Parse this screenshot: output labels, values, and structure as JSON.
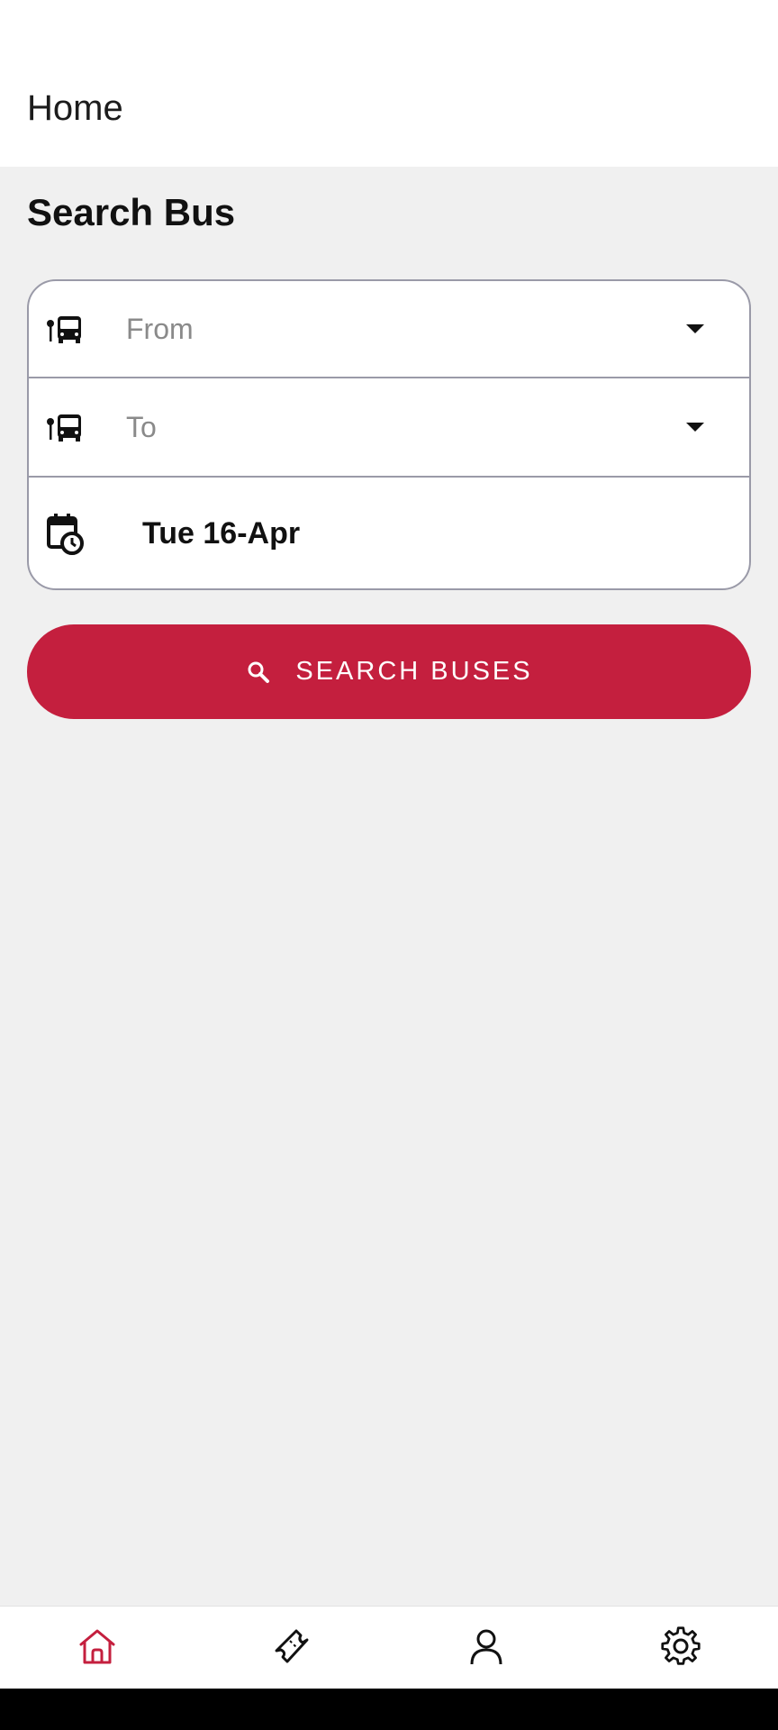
{
  "app_bar": {
    "title": "Home"
  },
  "search": {
    "section_title": "Search Bus",
    "from_placeholder": "From",
    "to_placeholder": "To",
    "date_value": "Tue 16-Apr",
    "button_label": "SEARCH BUSES"
  },
  "nav": {
    "items": [
      {
        "name": "home",
        "icon": "home-icon",
        "active": true
      },
      {
        "name": "tickets",
        "icon": "ticket-icon",
        "active": false
      },
      {
        "name": "profile",
        "icon": "person-icon",
        "active": false
      },
      {
        "name": "settings",
        "icon": "gear-icon",
        "active": false
      }
    ]
  },
  "colors": {
    "accent": "#c41f3e",
    "background": "#f0f0f0",
    "border": "#9a9aa8"
  }
}
